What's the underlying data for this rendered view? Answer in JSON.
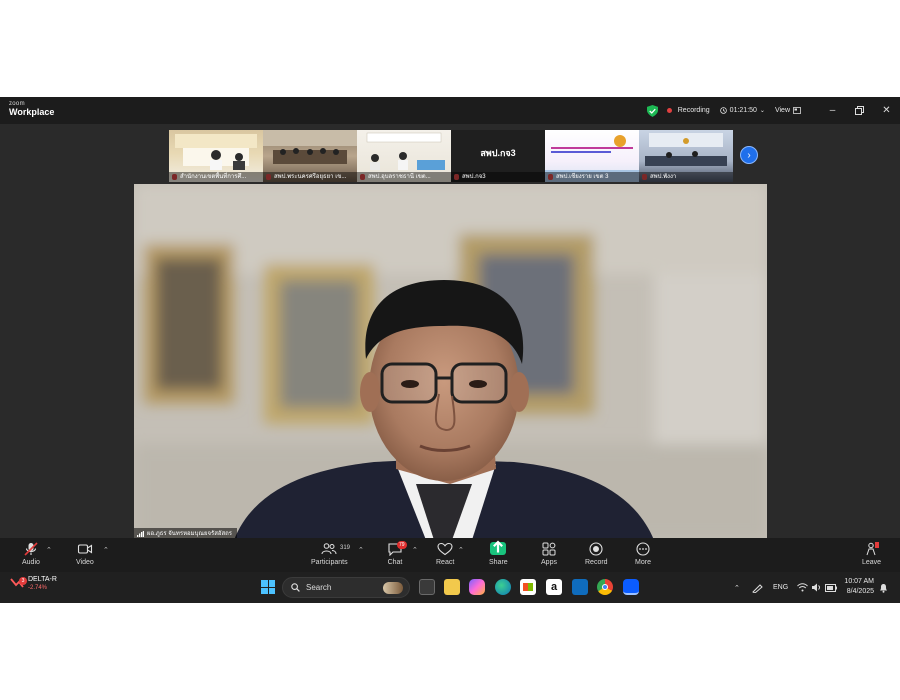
{
  "titlebar": {
    "brand_top": "zoom",
    "brand_bottom": "Workplace",
    "recording_label": "Recording",
    "timer": "01:21:50",
    "view_label": "View"
  },
  "thumbnails": [
    {
      "label": "สำนักงานเขตพื้นที่การศึ..."
    },
    {
      "label": "สพป.พระนครศรีอยุธยา เข..."
    },
    {
      "label": "สพป.อุบลราชธานี เขต..."
    },
    {
      "label": "สพป.กจ3",
      "tile_text": "สพป.กจ3"
    },
    {
      "label": "สพป.เชียงราย เขต 3"
    },
    {
      "label": "สพป.พังงา"
    }
  ],
  "speaker": {
    "name": "ผอ.ภูธร จันทรหอมบุณยจรัสอัสถร"
  },
  "toolbar": {
    "audio": "Audio",
    "video": "Video",
    "participants": "Participants",
    "participants_count": "319",
    "chat": "Chat",
    "chat_badge": "79",
    "react": "React",
    "share": "Share",
    "apps": "Apps",
    "record": "Record",
    "more": "More",
    "leave": "Leave"
  },
  "taskbar": {
    "stock_name": "DELTA-R",
    "stock_change": "-2.74%",
    "stock_badge": "3",
    "search_placeholder": "Search",
    "language": "ENG",
    "time": "10:07 AM",
    "date": "8/4/2025"
  },
  "colors": {
    "share_green": "#19c37d",
    "accent_blue": "#1f6feb",
    "alert_red": "#e02e2e"
  }
}
